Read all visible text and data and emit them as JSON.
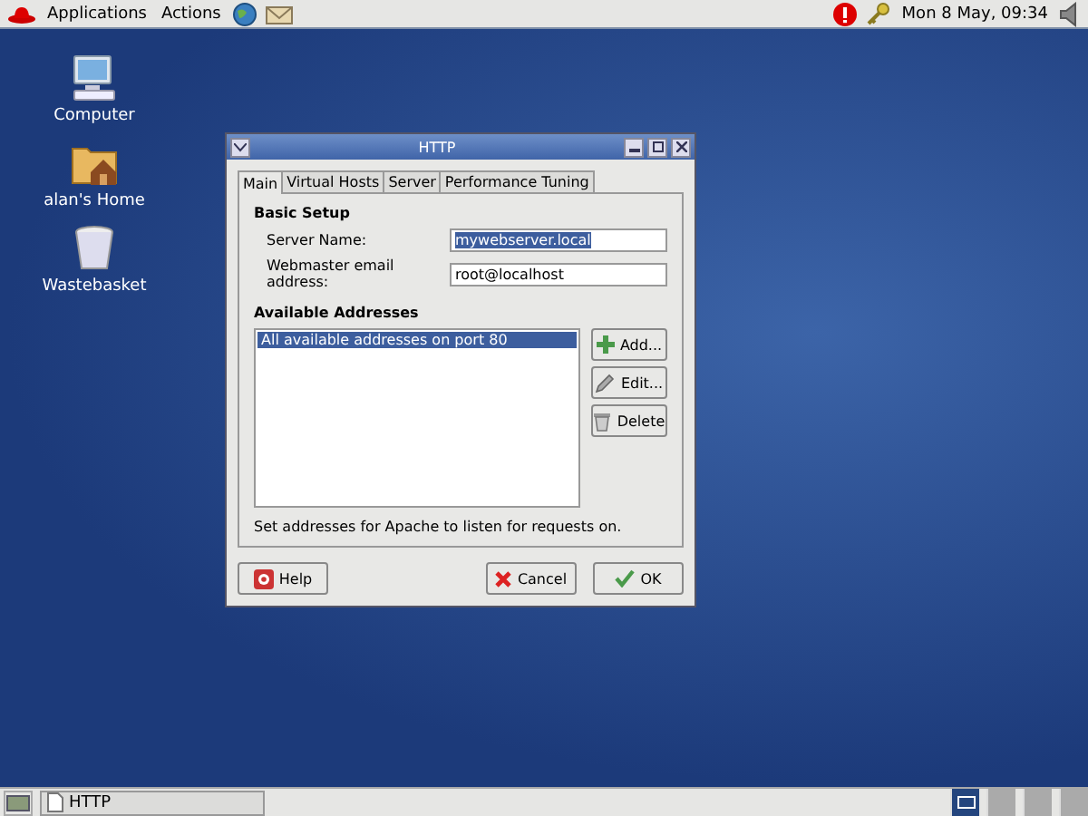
{
  "top_panel": {
    "menus": [
      "Applications",
      "Actions"
    ],
    "clock": "Mon  8 May, 09:34"
  },
  "desktop_icons": [
    {
      "kind": "computer",
      "label": "Computer"
    },
    {
      "kind": "home",
      "label": "alan's Home"
    },
    {
      "kind": "trash",
      "label": "Wastebasket"
    }
  ],
  "dialog": {
    "title": "HTTP",
    "tabs": [
      {
        "label": "Main",
        "selected": true
      },
      {
        "label": "Virtual Hosts",
        "selected": false
      },
      {
        "label": "Server",
        "selected": false
      },
      {
        "label": "Performance Tuning",
        "selected": false
      }
    ],
    "basic_setup": {
      "heading": "Basic Setup",
      "fields": [
        {
          "label": "Server Name:",
          "value": "mywebserver.local",
          "text_selected": true
        },
        {
          "label": "Webmaster email address:",
          "value": "root@localhost",
          "text_selected": false
        }
      ]
    },
    "addresses": {
      "heading": "Available Addresses",
      "items": [
        {
          "text": "All available addresses on port 80",
          "selected": true
        }
      ],
      "buttons": [
        {
          "kind": "add",
          "label": "Add..."
        },
        {
          "kind": "edit",
          "label": "Edit..."
        },
        {
          "kind": "delete",
          "label": "Delete"
        }
      ],
      "hint": "Set addresses for Apache to listen for requests on."
    },
    "footer_buttons": [
      {
        "kind": "help",
        "label": "Help"
      },
      {
        "kind": "cancel",
        "label": "Cancel"
      },
      {
        "kind": "ok",
        "label": "OK"
      }
    ]
  },
  "taskbar": {
    "tasks": [
      {
        "label": "HTTP"
      }
    ],
    "workspaces": [
      {
        "selected": true
      },
      {
        "selected": false
      },
      {
        "selected": false
      },
      {
        "selected": false
      }
    ]
  }
}
